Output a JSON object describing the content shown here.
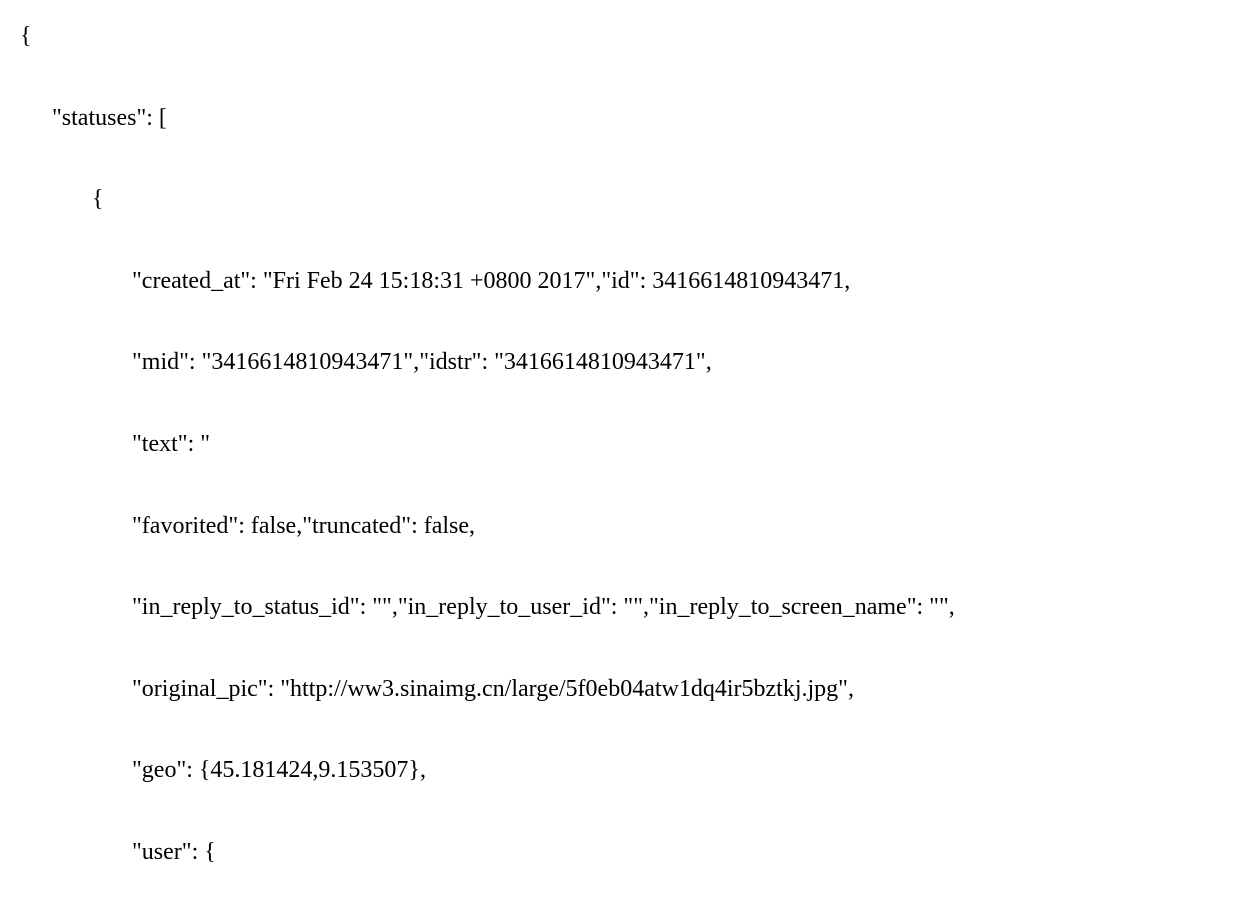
{
  "json_snippet": {
    "lines": [
      {
        "indent": "i0",
        "text": "{"
      },
      {
        "indent": "i1",
        "text": "\"statuses\": ["
      },
      {
        "indent": "i2",
        "text": "{"
      },
      {
        "indent": "i3",
        "text": "\"created_at\": \"Fri Feb 24 15:18:31 +0800 2017\",\"id\": 3416614810943471,"
      },
      {
        "indent": "i3",
        "text": "\"mid\": \"3416614810943471\",\"idstr\": \"3416614810943471\","
      },
      {
        "indent": "i3",
        "text": "\"text\": \""
      },
      {
        "indent": "i3",
        "text": "\"favorited\": false,\"truncated\": false,"
      },
      {
        "indent": "i3",
        "text": "\"in_reply_to_status_id\": \"\",\"in_reply_to_user_id\": \"\",\"in_reply_to_screen_name\": \"\","
      },
      {
        "indent": "i3",
        "text": "\"original_pic\": \"http://ww3.sinaimg.cn/large/5f0eb04atw1dq4ir5bztkj.jpg\","
      },
      {
        "indent": "i3",
        "text": "\"geo\": {45.181424,9.153507},"
      },
      {
        "indent": "i3",
        "text": "\"user\": {"
      }
    ]
  }
}
